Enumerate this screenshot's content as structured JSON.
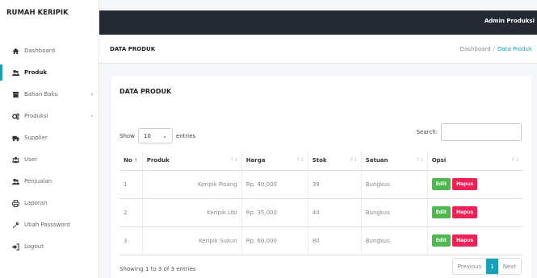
{
  "sidebar": {
    "brand": "RUMAH KERIPIK",
    "items": [
      {
        "label": "Dashboard",
        "icon": "home-icon",
        "active": false,
        "chevron": false
      },
      {
        "label": "Produk",
        "icon": "users-icon",
        "active": true,
        "chevron": false
      },
      {
        "label": "Bahan Baku",
        "icon": "box-icon",
        "active": false,
        "chevron": true
      },
      {
        "label": "Produksi",
        "icon": "gears-icon",
        "active": false,
        "chevron": true
      },
      {
        "label": "Supplier",
        "icon": "truck-icon",
        "active": false,
        "chevron": false
      },
      {
        "label": "User",
        "icon": "user-group-icon",
        "active": false,
        "chevron": false
      },
      {
        "label": "Penjualan",
        "icon": "users-icon",
        "active": false,
        "chevron": false
      },
      {
        "label": "Laporan",
        "icon": "print-icon",
        "active": false,
        "chevron": false
      },
      {
        "label": "Ubah Passsword",
        "icon": "wrench-icon",
        "active": false,
        "chevron": false
      },
      {
        "label": "Logout",
        "icon": "logout-icon",
        "active": false,
        "chevron": false
      }
    ]
  },
  "topbar": {
    "user": "Admin Produksi"
  },
  "header": {
    "title": "DATA PRODUK",
    "breadcrumb": [
      "Dashboard",
      "/",
      "Data Produk"
    ]
  },
  "card": {
    "title": "DATA PRODUK",
    "show_label": "Show",
    "length_value": "10",
    "entries_label": "entries",
    "search_label": "Search:",
    "search_value": "",
    "columns": [
      "No",
      "Produk",
      "Harga",
      "Stok",
      "Satuan",
      "Opsi"
    ],
    "rows": [
      {
        "no": "1",
        "produk": "Keripik Pisang",
        "harga": "Rp. 40,000",
        "stok": "39",
        "satuan": "Bungkus"
      },
      {
        "no": "2",
        "produk": "Keripik Ubi",
        "harga": "Rp. 35,000",
        "stok": "40",
        "satuan": "Bungkus"
      },
      {
        "no": "3",
        "produk": "Keripik Sukun",
        "harga": "Rp. 60,000",
        "stok": "80",
        "satuan": "Bungkus"
      }
    ],
    "edit_label": "Edit",
    "hapus_label": "Hapus",
    "info": "Showing 1 to 3 of 3 entries",
    "pager": {
      "previous": "Previous",
      "current": "1",
      "next": "Next"
    }
  },
  "colors": {
    "topbar": "#252934",
    "accent": "#17a2b8",
    "edit": "#4cb94c",
    "hapus": "#ee2155"
  }
}
